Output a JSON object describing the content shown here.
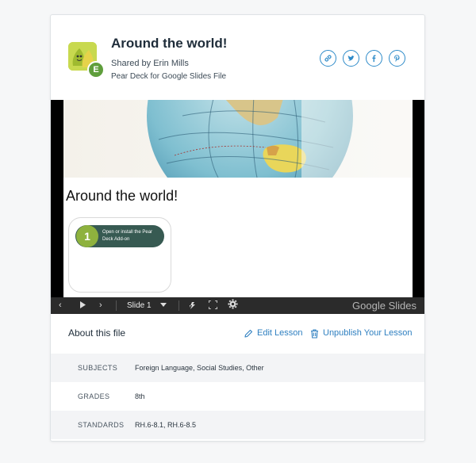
{
  "lesson": {
    "title": "Around the world!",
    "shared_by": "Shared by Erin Mills",
    "file_type": "Pear Deck for Google Slides File",
    "avatar_initial": "E"
  },
  "social": [
    {
      "icon": "link-icon",
      "glyph": "🔗"
    },
    {
      "icon": "twitter-icon",
      "glyph": "t"
    },
    {
      "icon": "facebook-icon",
      "glyph": "f"
    },
    {
      "icon": "pinterest-icon",
      "glyph": "P"
    }
  ],
  "preview": {
    "slide_title": "Around the world!",
    "addon_number": "1",
    "addon_text": "Open or install the Pear Deck Add-on",
    "slide_label": "Slide 1",
    "brand": "Google Slides"
  },
  "about": {
    "label": "About this file",
    "edit_label": "Edit Lesson",
    "unpublish_label": "Unpublish Your Lesson"
  },
  "details": [
    {
      "key": "SUBJECTS",
      "value": "Foreign Language, Social Studies, Other"
    },
    {
      "key": "GRADES",
      "value": "8th"
    },
    {
      "key": "STANDARDS",
      "value": "RH.6-8.1, RH.6-8.5"
    }
  ],
  "colors": {
    "accent": "#2e7fc0",
    "badge": "#5f9e3c",
    "pill": "#375a52",
    "pill_num": "#8eb23e"
  }
}
